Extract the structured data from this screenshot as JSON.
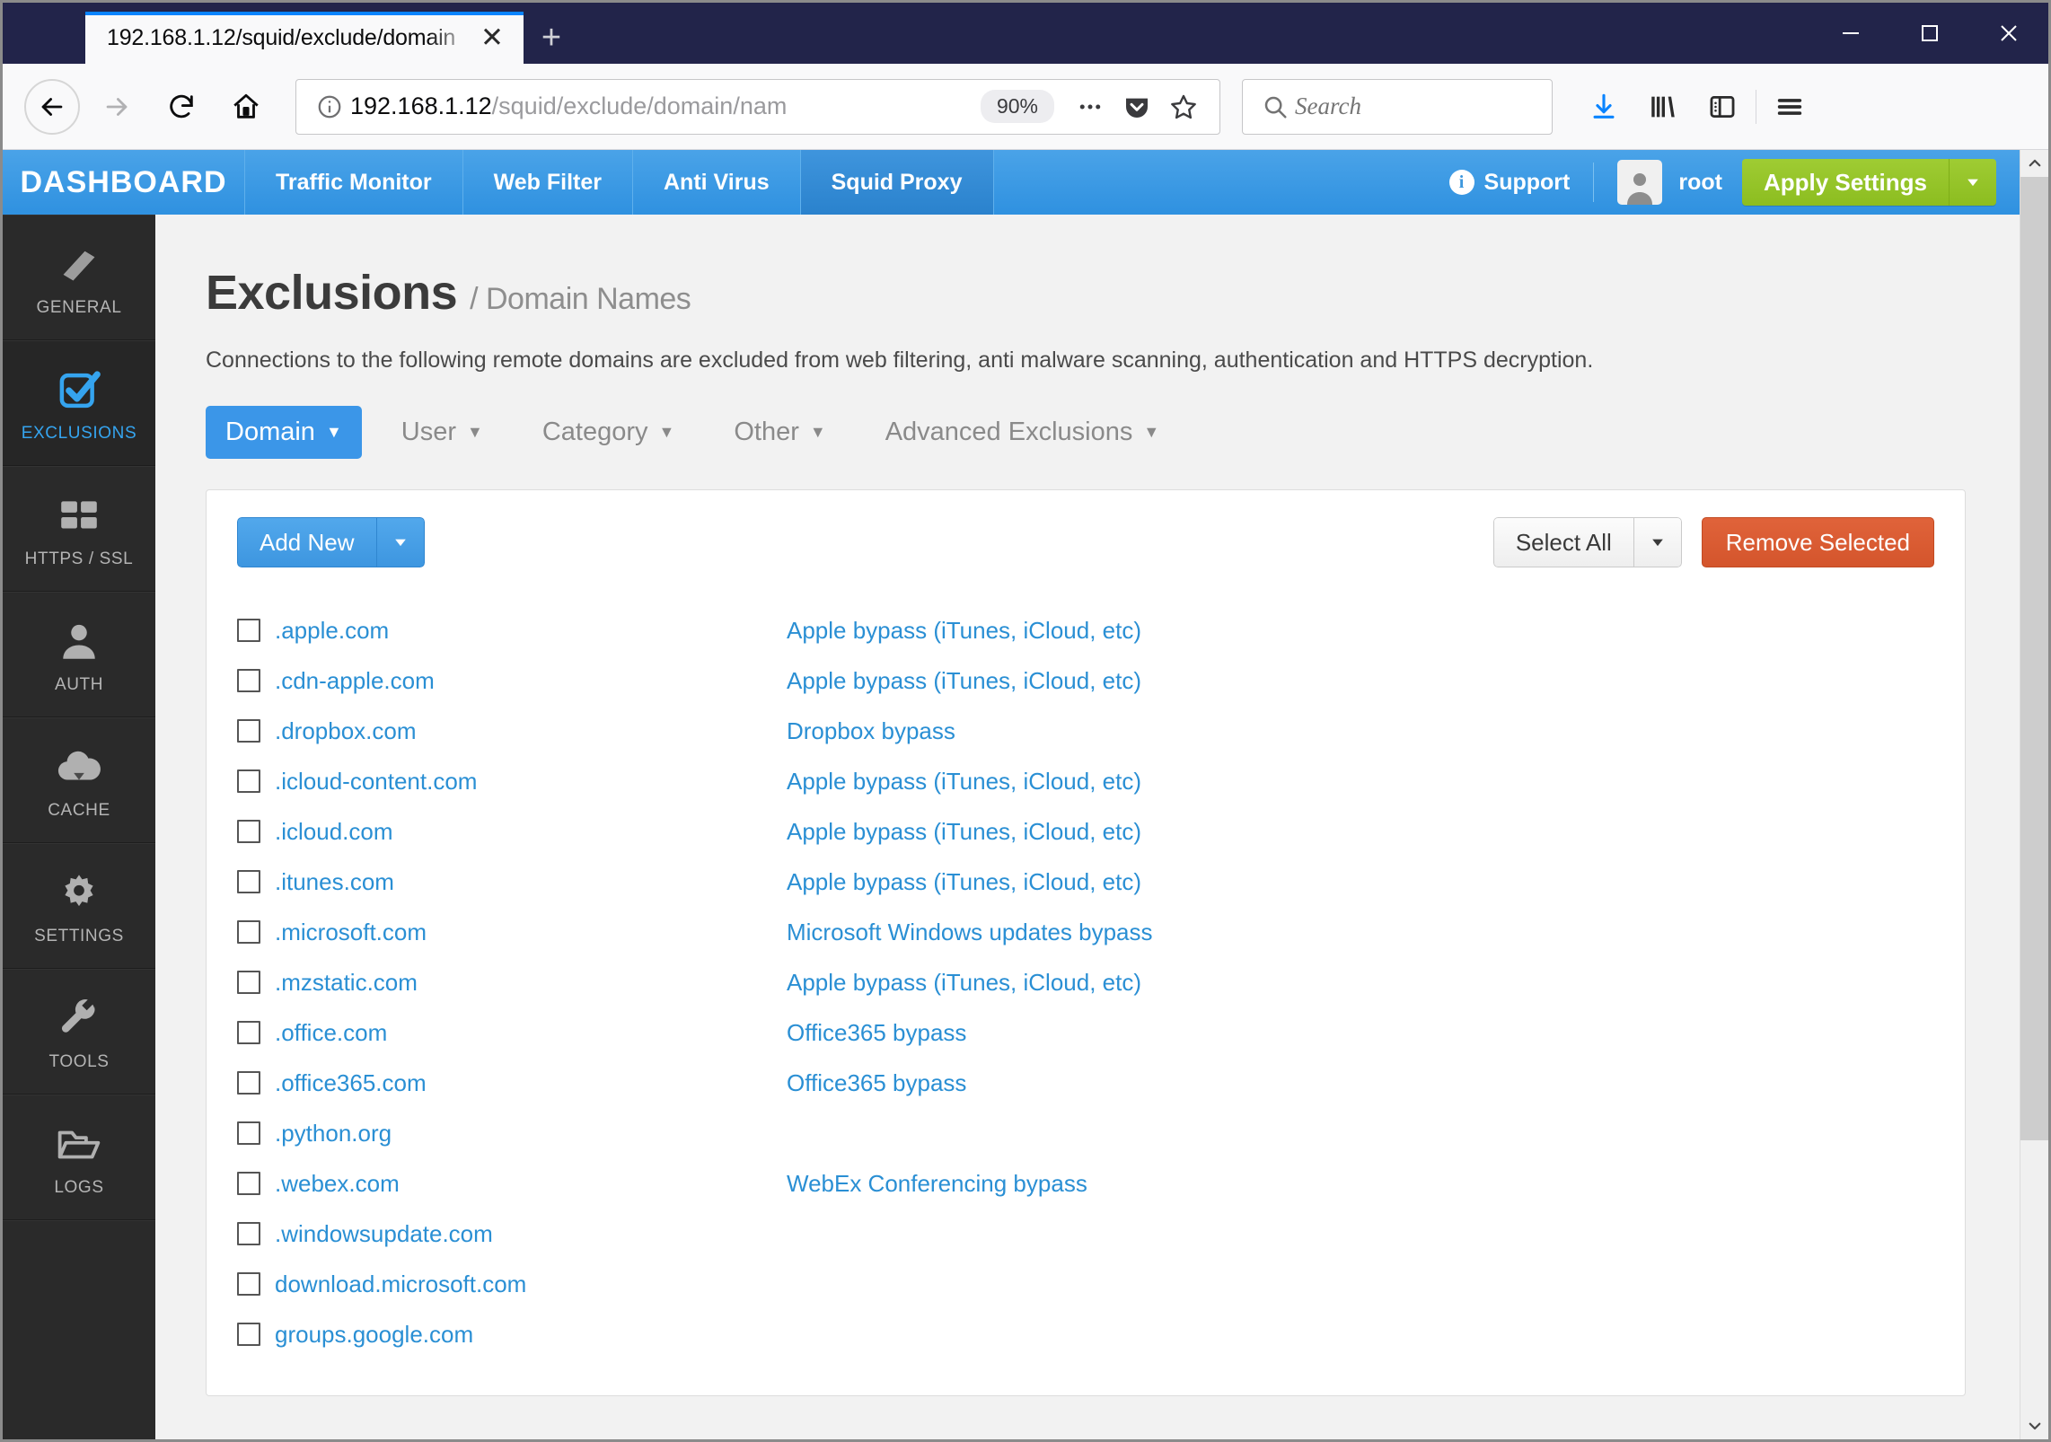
{
  "browser": {
    "tab_title": "192.168.1.12/squid/exclude/domain",
    "new_tab_label": "+",
    "close_tab_label": "✕",
    "url_host": "192.168.1.12",
    "url_path": "/squid/exclude/domain/nam",
    "zoom_level": "90%",
    "search_placeholder": "Search",
    "minimize_label": "—",
    "maximize_label": "□",
    "close_label": "✕"
  },
  "appnav": {
    "brand": "DASHBOARD",
    "items": [
      {
        "label": "Traffic Monitor",
        "active": false
      },
      {
        "label": "Web Filter",
        "active": false
      },
      {
        "label": "Anti Virus",
        "active": false
      },
      {
        "label": "Squid Proxy",
        "active": true
      }
    ],
    "support_label": "Support",
    "user": "root",
    "apply_label": "Apply Settings"
  },
  "sidebar": {
    "items": [
      {
        "label": "GENERAL",
        "icon": "book-icon",
        "active": false
      },
      {
        "label": "EXCLUSIONS",
        "icon": "checkbox-icon",
        "active": true
      },
      {
        "label": "HTTPS / SSL",
        "icon": "grid-icon",
        "active": false
      },
      {
        "label": "AUTH",
        "icon": "user-icon",
        "active": false
      },
      {
        "label": "CACHE",
        "icon": "cloud-download-icon",
        "active": false
      },
      {
        "label": "SETTINGS",
        "icon": "gear-icon",
        "active": false
      },
      {
        "label": "TOOLS",
        "icon": "wrench-icon",
        "active": false
      },
      {
        "label": "LOGS",
        "icon": "folder-icon",
        "active": false
      }
    ]
  },
  "main": {
    "title": "Exclusions",
    "breadcrumb": "/ Domain Names",
    "description": "Connections to the following remote domains are excluded from web filtering, anti malware scanning, authentication and HTTPS decryption.",
    "filter_tabs": [
      {
        "label": "Domain",
        "active": true
      },
      {
        "label": "User",
        "active": false
      },
      {
        "label": "Category",
        "active": false
      },
      {
        "label": "Other",
        "active": false
      },
      {
        "label": "Advanced Exclusions",
        "active": false
      }
    ],
    "toolbar": {
      "add_new_label": "Add New",
      "select_all_label": "Select All",
      "remove_selected_label": "Remove Selected"
    },
    "domains": [
      {
        "name": ".apple.com",
        "description": "Apple bypass (iTunes, iCloud, etc)",
        "checked": false
      },
      {
        "name": ".cdn-apple.com",
        "description": "Apple bypass (iTunes, iCloud, etc)",
        "checked": false
      },
      {
        "name": ".dropbox.com",
        "description": "Dropbox bypass",
        "checked": false
      },
      {
        "name": ".icloud-content.com",
        "description": "Apple bypass (iTunes, iCloud, etc)",
        "checked": false
      },
      {
        "name": ".icloud.com",
        "description": "Apple bypass (iTunes, iCloud, etc)",
        "checked": false
      },
      {
        "name": ".itunes.com",
        "description": "Apple bypass (iTunes, iCloud, etc)",
        "checked": false
      },
      {
        "name": ".microsoft.com",
        "description": "Microsoft Windows updates bypass",
        "checked": false
      },
      {
        "name": ".mzstatic.com",
        "description": "Apple bypass (iTunes, iCloud, etc)",
        "checked": false
      },
      {
        "name": ".office.com",
        "description": "Office365 bypass",
        "checked": false
      },
      {
        "name": ".office365.com",
        "description": "Office365 bypass",
        "checked": false
      },
      {
        "name": ".python.org",
        "description": "",
        "checked": false
      },
      {
        "name": ".webex.com",
        "description": "WebEx Conferencing bypass",
        "checked": false
      },
      {
        "name": ".windowsupdate.com",
        "description": "",
        "checked": false
      },
      {
        "name": "download.microsoft.com",
        "description": "",
        "checked": false
      },
      {
        "name": "groups.google.com",
        "description": "",
        "checked": false
      }
    ]
  },
  "colors": {
    "accent_blue": "#3b96e8",
    "link_blue": "#2a8fd4",
    "apply_green": "#9fcc33",
    "danger_orange": "#d4552c",
    "titlebar_navy": "#22244a",
    "sidebar_dark": "#2a2a2a"
  }
}
